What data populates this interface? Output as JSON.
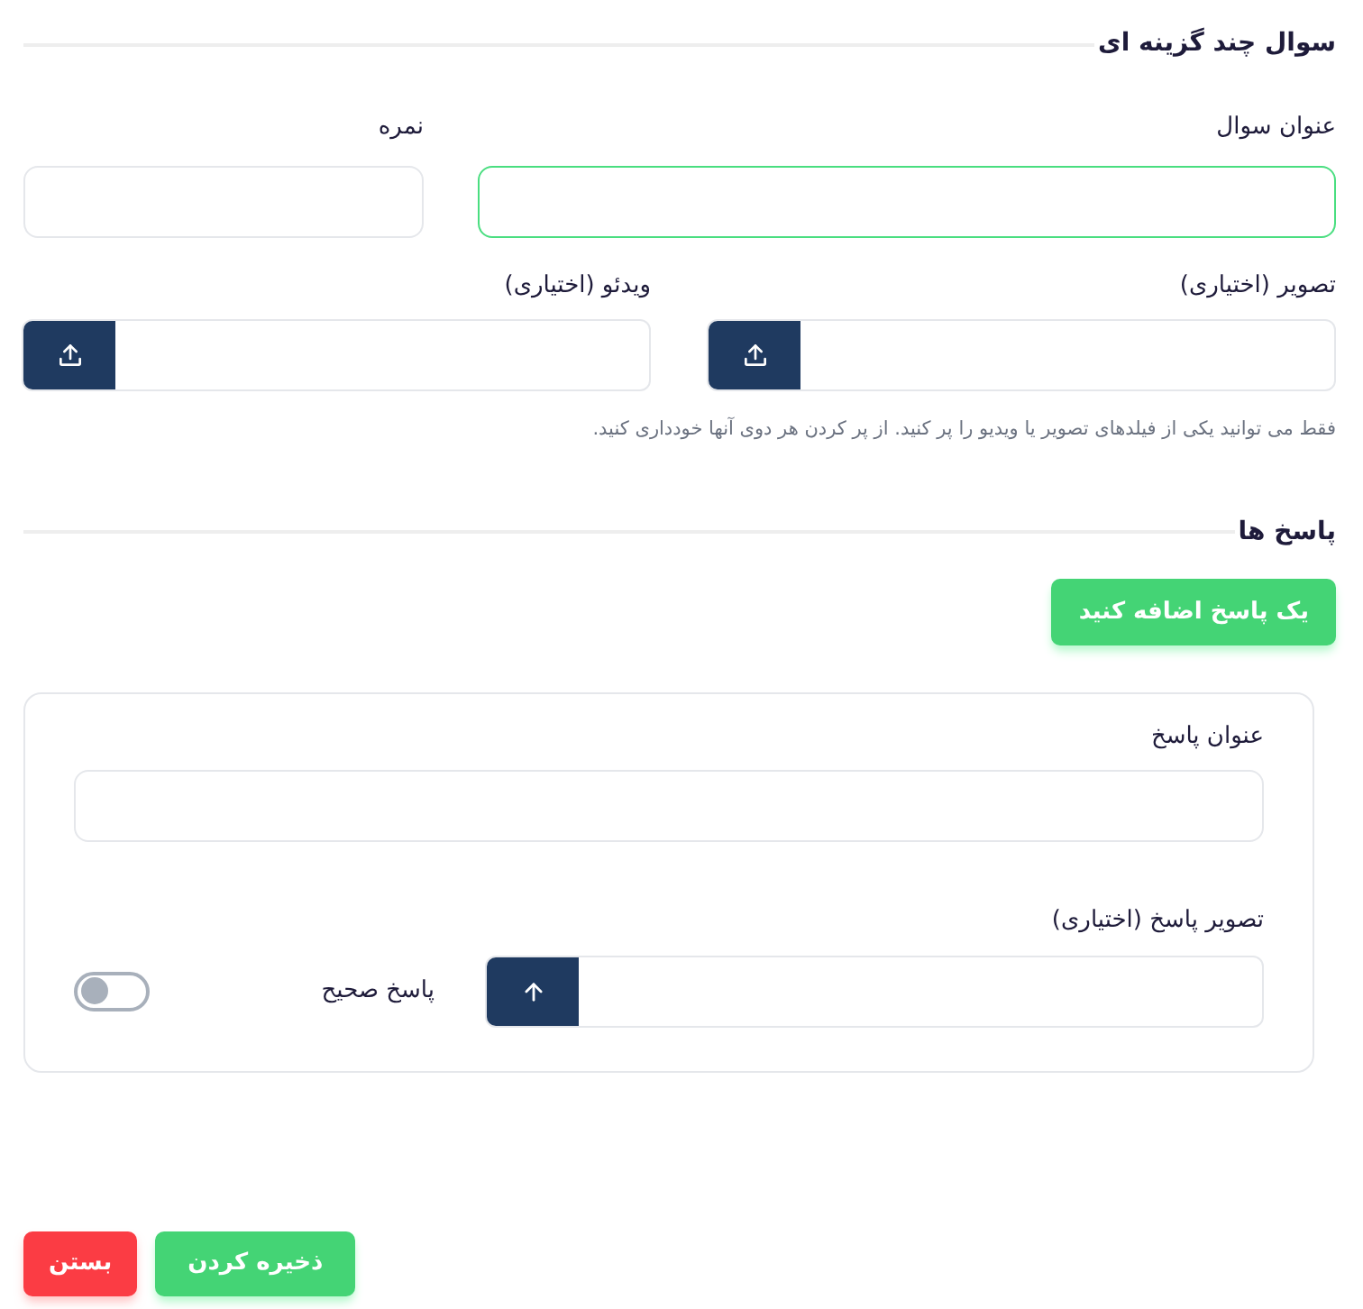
{
  "title": "سوال چند گزینه ای",
  "fields": [
    {
      "label": "عنوان سوال",
      "focused": true
    },
    {
      "label": "نمره",
      "focused": false
    }
  ],
  "uploads": [
    {
      "label": "تصویر (اختیاری)"
    },
    {
      "label": "ویدئو (اختیاری)"
    }
  ],
  "hint": "فقط می توانید یکی از فیلدهای تصویر یا ویدیو را پر کنید. از پر کردن هر دوی آنها خودداری کنید.",
  "answers_heading": "پاسخ ها",
  "add_answer_button": "یک پاسخ اضافه کنید",
  "answers": [
    {
      "title_label": "عنوان پاسخ",
      "image_label": "تصویر پاسخ (اختیاری)",
      "correct_label": "پاسخ صحیح",
      "correct": false
    }
  ],
  "actions": [
    {
      "label": "ذخیره کردن",
      "kind": "primary"
    },
    {
      "label": "بستن",
      "kind": "danger"
    }
  ]
}
